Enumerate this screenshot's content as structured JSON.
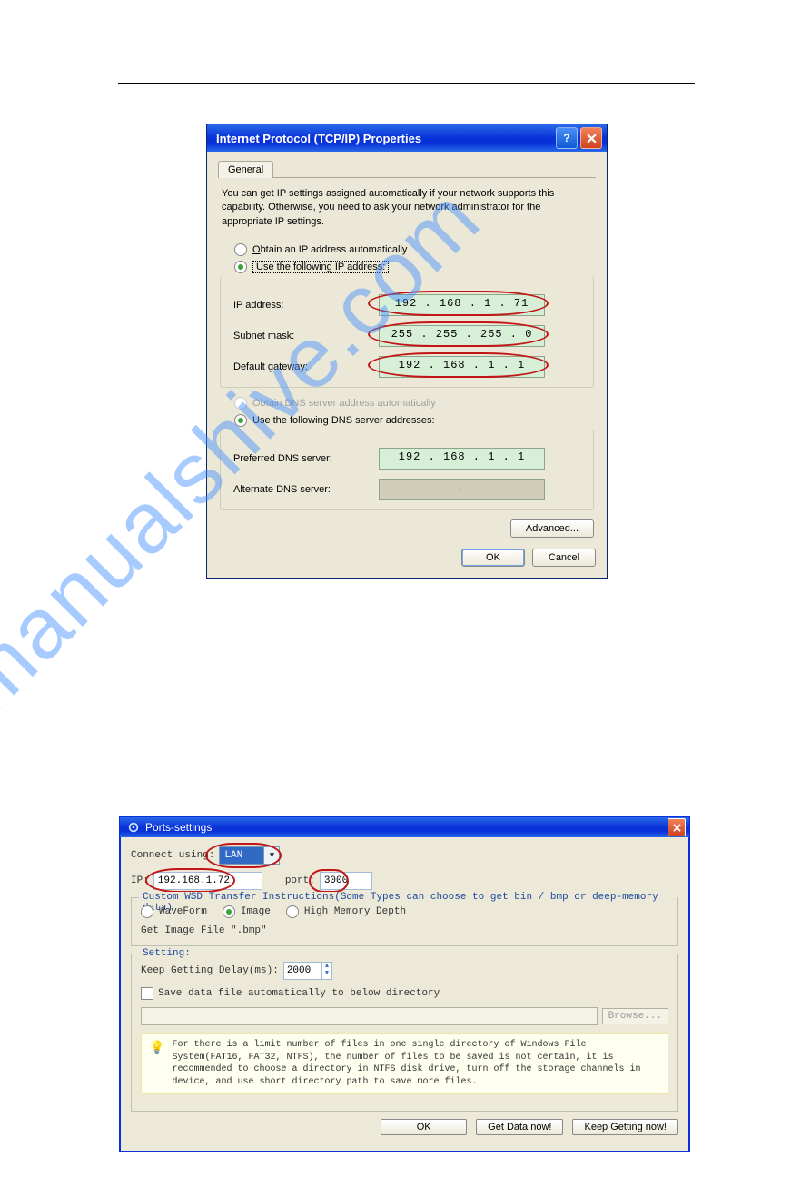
{
  "watermark": "manualshive.com",
  "tcpip": {
    "title": "Internet Protocol (TCP/IP) Properties",
    "tab_general": "General",
    "description": "You can get IP settings assigned automatically if your network supports this capability. Otherwise, you need to ask your network administrator for the appropriate IP settings.",
    "radio_obtain_ip": "Obtain an IP address automatically",
    "radio_use_ip": "Use the following IP address:",
    "label_ip": "IP address:",
    "label_subnet": "Subnet mask:",
    "label_gateway": "Default gateway:",
    "val_ip": "192 . 168 .  1  . 71",
    "val_subnet": "255 . 255 . 255 .  0",
    "val_gateway": "192 . 168 .  1  .  1",
    "radio_obtain_dns": "Obtain DNS server address automatically",
    "radio_use_dns": "Use the following DNS server addresses:",
    "label_pref_dns": "Preferred DNS server:",
    "label_alt_dns": "Alternate DNS server:",
    "val_pref_dns": "192 . 168 .  1  .  1",
    "val_alt_dns": ".",
    "btn_advanced": "Advanced...",
    "btn_ok": "OK",
    "btn_cancel": "Cancel"
  },
  "ports": {
    "title": "Ports-settings",
    "label_connect": "Connect using:",
    "val_connect": "LAN",
    "label_ip": "IP:",
    "val_ip": "192.168.1.72",
    "label_port": "port:",
    "val_port": "3000",
    "usb_legend": "Custom WSD Transfer Instructions(Some Types can choose to get bin / bmp or deep-memory data)",
    "radio_waveform": "WaveForm",
    "radio_image": "Image",
    "radio_highmem": "High Memory Depth",
    "get_image_label": "Get Image File \".bmp\"",
    "setting_legend": "Setting:",
    "keep_delay_label": "Keep Getting Delay(ms):",
    "keep_delay_val": "2000",
    "save_chk_label": "Save data file automatically to below directory",
    "browse_btn": "Browse...",
    "tip": "For there is a limit number of files in one single directory of Windows File System(FAT16, FAT32, NTFS), the number of  files to be saved is not certain,  it is recommended to choose a directory in NTFS disk drive, turn off the storage channels in device, and use short directory path to save more files.",
    "btn_ok": "OK",
    "btn_get": "Get Data now!",
    "btn_keep": "Keep Getting now!"
  }
}
